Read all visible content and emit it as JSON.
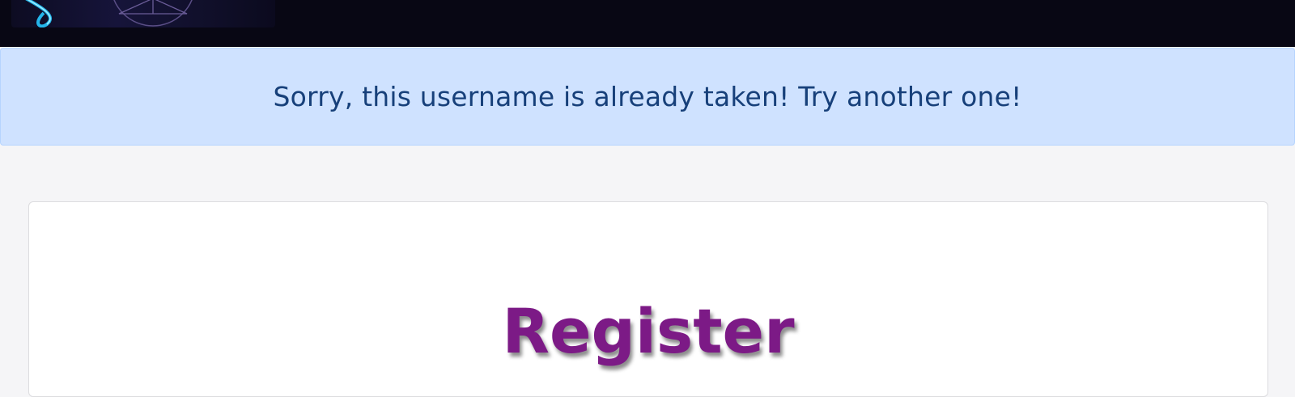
{
  "alert": {
    "message": "Sorry, this username is already taken! Try another one!"
  },
  "register_card": {
    "title": "Register"
  },
  "colors": {
    "navbar_bg": "#080714",
    "alert_bg": "#cfe2ff",
    "alert_text": "#17407a",
    "title": "#7c1a86"
  },
  "icons": {
    "logo": "site-logo-icon"
  }
}
